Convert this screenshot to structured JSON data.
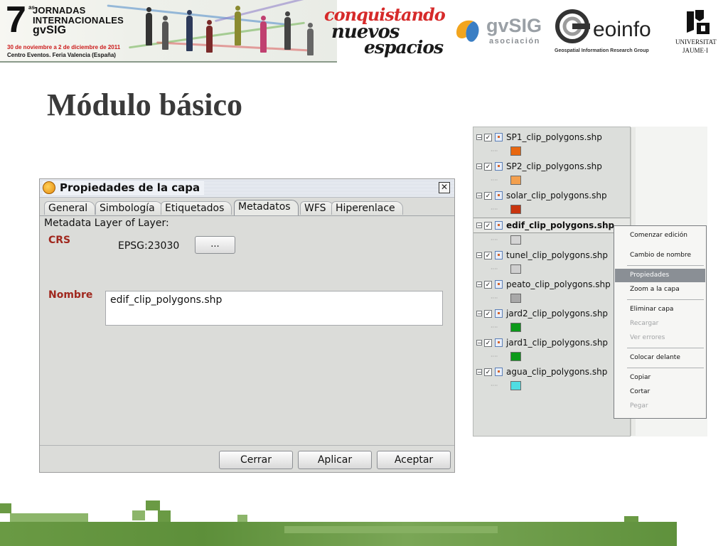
{
  "banner": {
    "event_number": "7",
    "event_ordinal": "as",
    "event_lines": [
      "JORNADAS",
      "INTERNACIONALES",
      "gvSIG"
    ],
    "event_dates": "30 de noviembre a 2 de diciembre de 2011",
    "event_place": "Centro Eventos. Feria Valencia (España)",
    "slogan": [
      "conquistando",
      "nuevos",
      "espacios"
    ],
    "gvsig_name": "gvSIG",
    "gvsig_sub": "asociación",
    "geoinfo_name": "eoinfo",
    "geoinfo_sub": "Geospatial Information Research Group",
    "uji_line1": "UNIVERSITAT",
    "uji_line2": "JAUME·I"
  },
  "slide": {
    "title": "Módulo básico"
  },
  "dialog": {
    "title": "Propiedades de la capa",
    "close_glyph": "✕",
    "tabs": [
      "General",
      "Simbología",
      "Etiquetados",
      "Metadatos",
      "WFS",
      "Hiperenlace"
    ],
    "active_tab": "Metadatos",
    "heading": "Metadata Layer of Layer:",
    "crs_label": "CRS",
    "crs_value": "EPSG:23030",
    "crs_button": "...",
    "name_label": "Nombre",
    "name_value": "edif_clip_polygons.shp",
    "buttons": {
      "close": "Cerrar",
      "apply": "Aplicar",
      "accept": "Aceptar"
    }
  },
  "toc": {
    "layers": [
      {
        "name": "SP1_clip_polygons.shp",
        "color": "#e8670f",
        "checked": "✓"
      },
      {
        "name": "SP2_clip_polygons.shp",
        "color": "#f3a04e",
        "checked": "✓"
      },
      {
        "name": "solar_clip_polygons.shp",
        "color": "#c8350f",
        "checked": "✓"
      },
      {
        "name": "edif_clip_polygons.shp",
        "color": "#d4d4d4",
        "checked": "✓",
        "selected": true
      },
      {
        "name": "tunel_clip_polygons.shp",
        "color": "#cfcfcf",
        "checked": "✓"
      },
      {
        "name": "peato_clip_polygons.shp",
        "color": "#a8a8a8",
        "checked": "✓"
      },
      {
        "name": "jard2_clip_polygons.shp",
        "color": "#0c9a1a",
        "checked": "✓"
      },
      {
        "name": "jard1_clip_polygons.shp",
        "color": "#0c9a1a",
        "checked": "✓"
      },
      {
        "name": "agua_clip_polygons.shp",
        "color": "#4fdde2",
        "checked": "✓"
      }
    ],
    "expander_glyph": "−",
    "legend_dots": "····"
  },
  "context_menu": {
    "items": [
      {
        "label": "Comenzar edición",
        "disabled": false
      },
      {
        "label": "Cambio de nombre",
        "disabled": false
      },
      {
        "label": "Propiedades",
        "disabled": false,
        "highlight": true
      },
      {
        "label": "Zoom a la capa",
        "disabled": false
      },
      {
        "label": "Eliminar capa",
        "disabled": false
      },
      {
        "label": "Recargar",
        "disabled": true
      },
      {
        "label": "Ver errores",
        "disabled": true
      },
      {
        "label": "Colocar delante",
        "disabled": false
      },
      {
        "label": "Copiar",
        "disabled": false
      },
      {
        "label": "Cortar",
        "disabled": false
      },
      {
        "label": "Pegar",
        "disabled": true
      }
    ]
  },
  "colors": {
    "accent_title": "#3a3a3a",
    "label_red": "#a0281e",
    "deco_green": "#6a9a44"
  }
}
